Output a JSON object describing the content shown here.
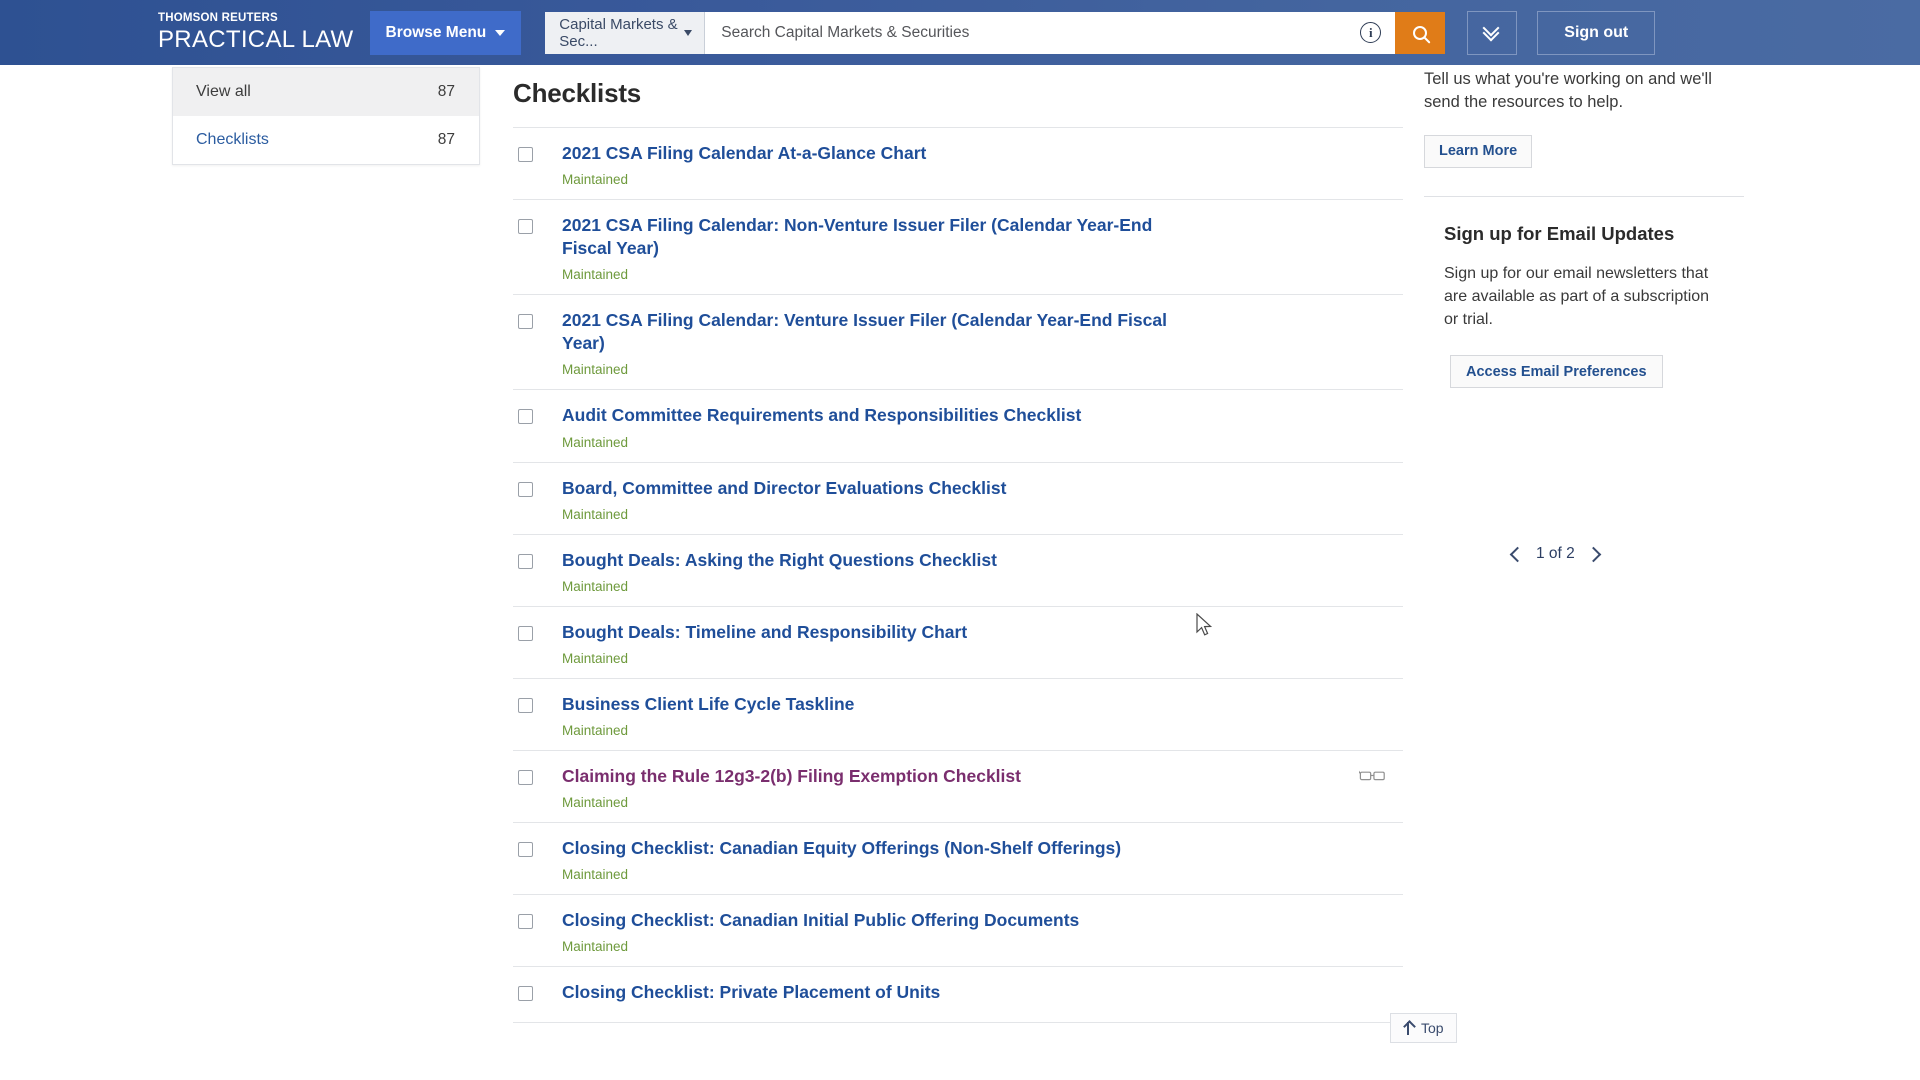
{
  "header": {
    "brand_top": "THOMSON REUTERS",
    "brand_main": "PRACTICAL LAW",
    "browse_menu": "Browse Menu",
    "search_scope": "Capital Markets & Sec...",
    "search_placeholder": "Search Capital Markets & Securities",
    "search_value": "",
    "info_glyph": "i",
    "sign_out": "Sign out",
    "icons": {
      "search": "magnifier-icon",
      "expand": "double-chevron-down-icon",
      "info": "info-circle-icon"
    },
    "colors": {
      "bar": "#39599a",
      "browse_button": "#3f6bc9",
      "search_button": "#e07c18"
    }
  },
  "facets": {
    "items": [
      {
        "label": "View all",
        "count": "87",
        "active": true
      },
      {
        "label": "Checklists",
        "count": "87",
        "active": false
      }
    ]
  },
  "main": {
    "title": "Checklists",
    "results": [
      {
        "title": "2021 CSA Filing Calendar At-a-Glance Chart",
        "status": "Maintained",
        "visited": false,
        "recently_viewed": false
      },
      {
        "title": "2021 CSA Filing Calendar: Non-Venture Issuer Filer (Calendar Year-End Fiscal Year)",
        "status": "Maintained",
        "visited": false,
        "recently_viewed": false
      },
      {
        "title": "2021 CSA Filing Calendar: Venture Issuer Filer (Calendar Year-End Fiscal Year)",
        "status": "Maintained",
        "visited": false,
        "recently_viewed": false
      },
      {
        "title": "Audit Committee Requirements and Responsibilities Checklist",
        "status": "Maintained",
        "visited": false,
        "recently_viewed": false
      },
      {
        "title": "Board, Committee and Director Evaluations Checklist",
        "status": "Maintained",
        "visited": false,
        "recently_viewed": false
      },
      {
        "title": "Bought Deals: Asking the Right Questions Checklist",
        "status": "Maintained",
        "visited": false,
        "recently_viewed": false
      },
      {
        "title": "Bought Deals: Timeline and Responsibility Chart",
        "status": "Maintained",
        "visited": false,
        "recently_viewed": false
      },
      {
        "title": "Business Client Life Cycle Taskline",
        "status": "Maintained",
        "visited": false,
        "recently_viewed": false
      },
      {
        "title": "Claiming the Rule 12g3-2(b) Filing Exemption Checklist",
        "status": "Maintained",
        "visited": true,
        "recently_viewed": true
      },
      {
        "title": "Closing Checklist: Canadian Equity Offerings (Non-Shelf Offerings)",
        "status": "Maintained",
        "visited": false,
        "recently_viewed": false
      },
      {
        "title": "Closing Checklist: Canadian Initial Public Offering Documents",
        "status": "Maintained",
        "visited": false,
        "recently_viewed": false
      },
      {
        "title": "Closing Checklist: Private Placement of Units",
        "status": "",
        "visited": false,
        "recently_viewed": false
      }
    ],
    "status_color": "#6e9a3c",
    "link_color": "#1f4e99",
    "visited_link_color": "#7a2e6e"
  },
  "rail": {
    "promo_text": "Tell us what you're working on and we'll send the resources to help.",
    "learn_more": "Learn More",
    "email_heading": "Sign up for Email Updates",
    "email_text": "Sign up for our email newsletters that are available as part of a subscription or trial.",
    "email_button": "Access Email Preferences"
  },
  "pagination": {
    "label": "1 of 2",
    "prev_icon": "chevron-left-icon",
    "next_icon": "chevron-right-icon"
  },
  "back_to_top": {
    "label": "Top",
    "icon": "arrow-up-icon"
  }
}
